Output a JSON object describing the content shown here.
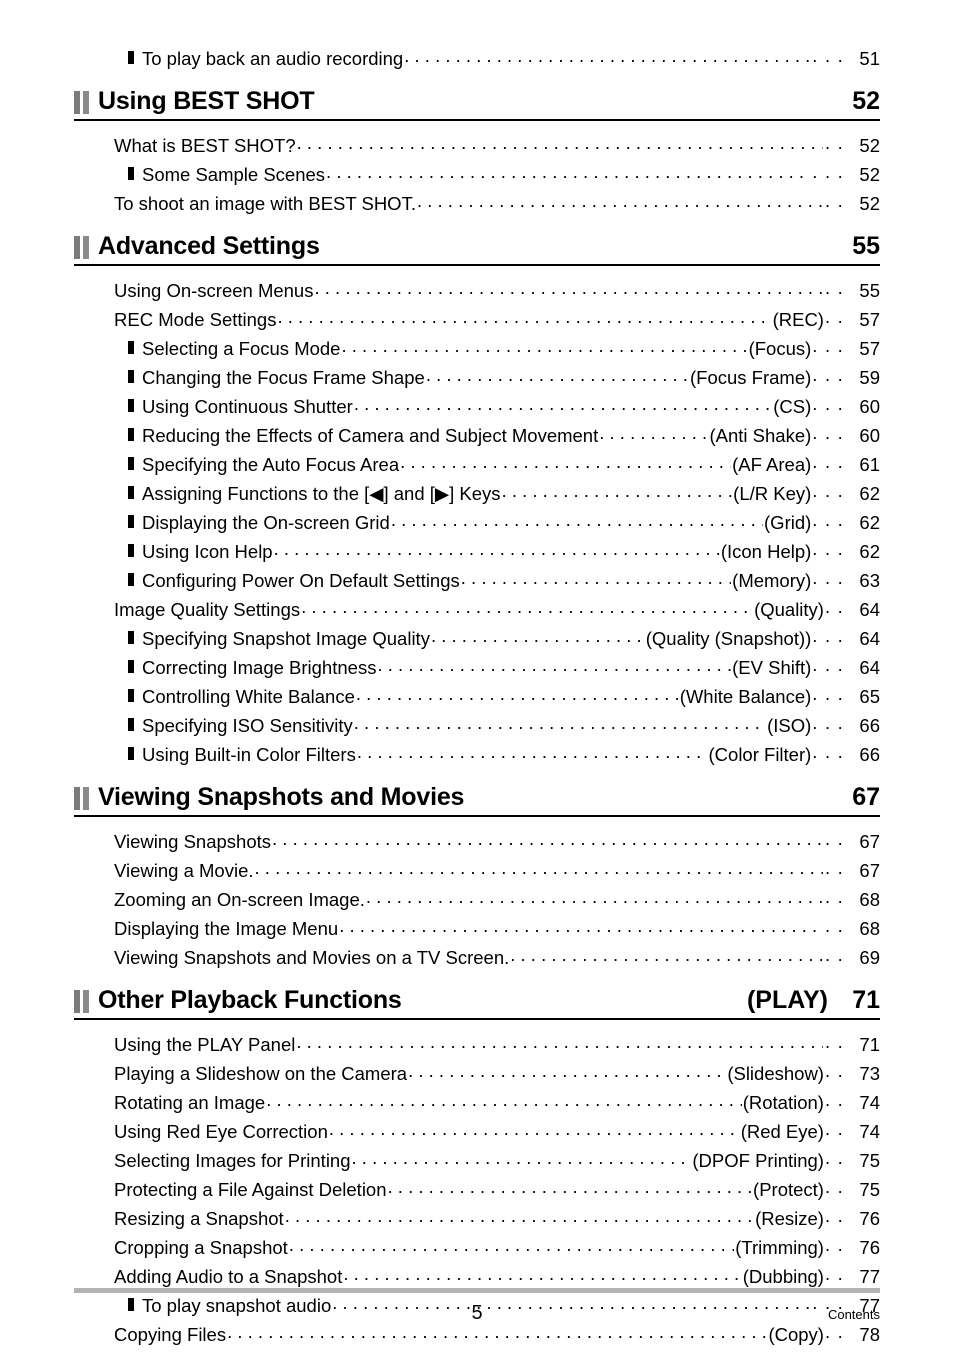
{
  "document": {
    "footer_page_number": "5",
    "footer_label": "Contents"
  },
  "top_orphan_entry": {
    "level": 2,
    "label": "To play back an audio recording",
    "tag": "",
    "page": "51"
  },
  "sections": [
    {
      "title": "Using BEST SHOT",
      "tag": "",
      "page": "52",
      "entries": [
        {
          "level": 1,
          "label": "What is BEST SHOT?",
          "tag": "",
          "page": "52",
          "wide": true
        },
        {
          "level": 2,
          "label": "Some Sample Scenes",
          "tag": "",
          "page": "52",
          "wide": false
        },
        {
          "level": 1,
          "label": "To shoot an image with BEST SHOT.",
          "tag": "",
          "page": "52",
          "wide": true
        }
      ]
    },
    {
      "title": "Advanced Settings",
      "tag": "",
      "page": "55",
      "entries": [
        {
          "level": 1,
          "label": "Using On-screen Menus",
          "tag": "",
          "page": "55",
          "wide": true
        },
        {
          "level": 1,
          "label": "REC Mode Settings",
          "tag": "(REC)",
          "page": "57",
          "wide": true
        },
        {
          "level": 2,
          "label": "Selecting a Focus Mode",
          "tag": "(Focus)",
          "page": "57",
          "wide": false
        },
        {
          "level": 2,
          "label": "Changing the Focus Frame Shape",
          "tag": "(Focus Frame)",
          "page": "59",
          "wide": false
        },
        {
          "level": 2,
          "label": "Using Continuous Shutter",
          "tag": "(CS)",
          "page": "60",
          "wide": false
        },
        {
          "level": 2,
          "label": "Reducing the Effects of Camera and Subject Movement",
          "tag": "(Anti Shake)",
          "page": "60",
          "wide": false
        },
        {
          "level": 2,
          "label": "Specifying the Auto Focus Area",
          "tag": "(AF Area)",
          "page": "61",
          "wide": false
        },
        {
          "level": 2,
          "label": "Assigning Functions to the [◀] and [▶] Keys",
          "tag": "(L/R Key)",
          "page": "62",
          "wide": false
        },
        {
          "level": 2,
          "label": "Displaying the On-screen Grid",
          "tag": "(Grid)",
          "page": "62",
          "wide": false
        },
        {
          "level": 2,
          "label": "Using Icon Help",
          "tag": "(Icon Help)",
          "page": "62",
          "wide": false
        },
        {
          "level": 2,
          "label": "Configuring Power On Default Settings",
          "tag": "(Memory)",
          "page": "63",
          "wide": false
        },
        {
          "level": 1,
          "label": "Image Quality Settings",
          "tag": "(Quality)",
          "page": "64",
          "wide": true
        },
        {
          "level": 2,
          "label": "Specifying Snapshot Image Quality",
          "tag": "(Quality (Snapshot))",
          "page": "64",
          "wide": false
        },
        {
          "level": 2,
          "label": "Correcting Image Brightness",
          "tag": "(EV Shift)",
          "page": "64",
          "wide": false
        },
        {
          "level": 2,
          "label": "Controlling White Balance",
          "tag": "(White Balance)",
          "page": "65",
          "wide": false
        },
        {
          "level": 2,
          "label": "Specifying ISO Sensitivity",
          "tag": "(ISO)",
          "page": "66",
          "wide": false
        },
        {
          "level": 2,
          "label": "Using Built-in Color Filters",
          "tag": "(Color Filter)",
          "page": "66",
          "wide": false
        }
      ]
    },
    {
      "title": "Viewing Snapshots and Movies",
      "tag": "",
      "page": "67",
      "entries": [
        {
          "level": 1,
          "label": "Viewing Snapshots",
          "tag": "",
          "page": "67",
          "wide": true
        },
        {
          "level": 1,
          "label": "Viewing a Movie.",
          "tag": "",
          "page": "67",
          "wide": true
        },
        {
          "level": 1,
          "label": "Zooming an On-screen Image.",
          "tag": "",
          "page": "68",
          "wide": true
        },
        {
          "level": 1,
          "label": "Displaying the Image Menu",
          "tag": "",
          "page": "68",
          "wide": true
        },
        {
          "level": 1,
          "label": "Viewing Snapshots and Movies on a TV Screen.",
          "tag": "",
          "page": "69",
          "wide": true
        }
      ]
    },
    {
      "title": "Other Playback Functions",
      "tag": "(PLAY)",
      "page": "71",
      "entries": [
        {
          "level": 1,
          "label": "Using the PLAY Panel",
          "tag": "",
          "page": "71",
          "wide": true
        },
        {
          "level": 1,
          "label": "Playing a Slideshow on the Camera",
          "tag": "(Slideshow)",
          "page": "73",
          "wide": true
        },
        {
          "level": 1,
          "label": "Rotating an Image",
          "tag": "(Rotation)",
          "page": "74",
          "wide": true
        },
        {
          "level": 1,
          "label": "Using Red Eye Correction",
          "tag": "(Red Eye)",
          "page": "74",
          "wide": true
        },
        {
          "level": 1,
          "label": "Selecting Images for Printing",
          "tag": "(DPOF Printing)",
          "page": "75",
          "wide": true
        },
        {
          "level": 1,
          "label": "Protecting a File Against Deletion",
          "tag": "(Protect)",
          "page": "75",
          "wide": true
        },
        {
          "level": 1,
          "label": "Resizing a Snapshot",
          "tag": "(Resize)",
          "page": "76",
          "wide": true
        },
        {
          "level": 1,
          "label": "Cropping a Snapshot",
          "tag": "(Trimming)",
          "page": "76",
          "wide": true
        },
        {
          "level": 1,
          "label": "Adding Audio to a Snapshot",
          "tag": "(Dubbing)",
          "page": "77",
          "wide": true
        },
        {
          "level": 2,
          "label": "To play snapshot audio",
          "tag": "",
          "page": "77",
          "wide": false
        },
        {
          "level": 1,
          "label": "Copying Files",
          "tag": "(Copy)",
          "page": "78",
          "wide": true
        }
      ]
    }
  ]
}
